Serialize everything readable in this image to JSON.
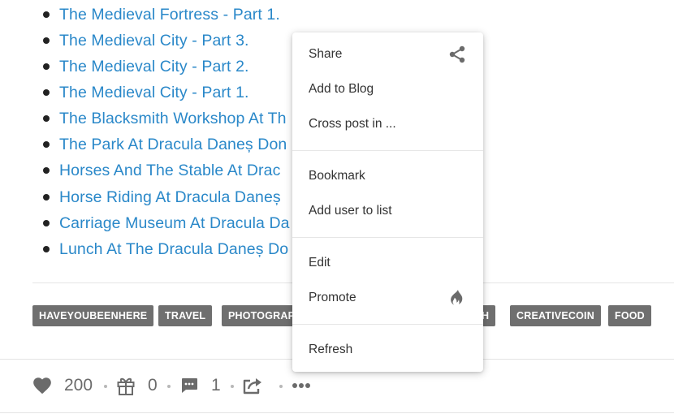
{
  "post_links": [
    "The Medieval Fortress - Part 1.",
    "The Medieval City - Part 3.",
    "The Medieval City - Part 2.",
    "The Medieval City - Part 1.",
    "The Blacksmith Workshop At Th",
    "The Park At Dracula Daneș Don",
    "Horses And The Stable At Drac",
    "Horse Riding At Dracula Daneș",
    "Carriage Museum At Dracula Da",
    "Lunch At The Dracula Daneș Do"
  ],
  "tags": [
    "HAVEYOUBEENHERE",
    "TRAVEL",
    "PHOTOGRAP",
    "H",
    "CREATIVECOIN",
    "FOOD"
  ],
  "footer": {
    "likes": "200",
    "gifts": "0",
    "comments": "1"
  },
  "context_menu": {
    "items": [
      "Share",
      "Add to Blog",
      "Cross post in ...",
      "Bookmark",
      "Add user to list",
      "Edit",
      "Promote",
      "Refresh"
    ]
  },
  "icons": {
    "heart": "heart-icon",
    "gift": "gift-icon",
    "comment": "comment-icon",
    "reblog": "reblog-icon",
    "more": "more-horizontal-icon",
    "share": "share-icon",
    "promote": "fire-icon"
  },
  "colors": {
    "link": "#2a88c9",
    "tag_bg": "#6f6f6f",
    "footer_icon": "#6b6b6b"
  }
}
